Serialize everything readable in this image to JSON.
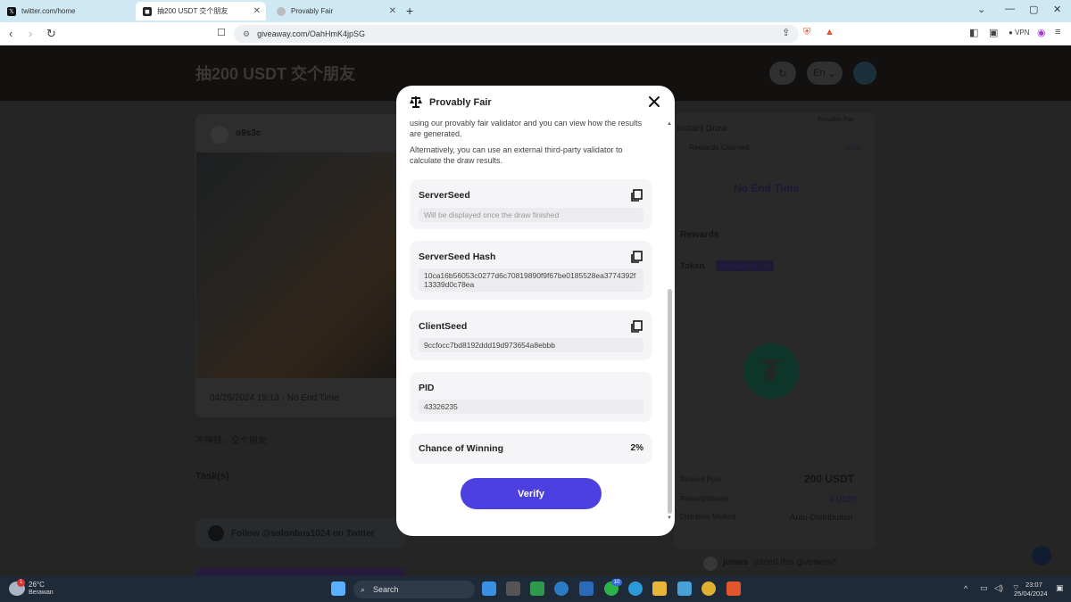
{
  "browser": {
    "tabs": [
      {
        "label": "twitter.com/home"
      },
      {
        "label": "抽200 USDT 交个朋友"
      },
      {
        "label": "Provably Fair"
      }
    ],
    "url": "giveaway.com/OahHmK4jpSG",
    "vpn_label": "VPN"
  },
  "page": {
    "title": "抽200 USDT 交个朋友",
    "lang": "En",
    "user": "o9s3c",
    "date_range": "04/25/2024 19:13 - No End Time",
    "description": "不挣钱，交个朋友",
    "tasks_heading": "Task(s)",
    "task_follow": "Follow",
    "task_handle": "@solonbus1024",
    "task_suffix": "on Twitter",
    "right": {
      "provably_fair": "Provably Fair",
      "instant_draw": "Instant Draw",
      "rewards_claimed": "Rewards Claimed",
      "rewards_count": "0/50",
      "no_end_time": "No End Time",
      "rewards_heading": "Rewards",
      "token_label": "Token",
      "remaining": "Remaining: 50",
      "reward_pool_label": "Reward Pool",
      "reward_pool_value": "200 USDT",
      "reward_winner_label": "Reward/Winner",
      "reward_winner_value": "4 USDT",
      "distribute_label": "Distribute Method",
      "distribute_value": "Auto-Distribution",
      "joined_user": "juwas",
      "joined_text": "joined this giveaway!"
    }
  },
  "modal": {
    "title": "Provably Fair",
    "intro_1": "using our provably fair validator and you can view how the results are generated.",
    "intro_2": "Alternatively, you can use an external third-party validator to calculate the draw results.",
    "fields": [
      {
        "label": "ServerSeed",
        "value": "Will be displayed once the draw finished"
      },
      {
        "label": "ServerSeed Hash",
        "value": "10ca16b56053c0277d6c70819890f9f67be0185528ea3774392f13339d0c78ea"
      },
      {
        "label": "ClientSeed",
        "value": "9ccfocc7bd8192ddd19d973654a8ebbb"
      },
      {
        "label": "PID",
        "value": "43326235"
      }
    ],
    "chance_label": "Chance of Winning",
    "chance_value": "2%",
    "verify_label": "Verify"
  },
  "taskbar": {
    "weather_temp": "26°C",
    "weather_desc": "Berawan",
    "search_label": "Search",
    "time": "23:07",
    "date": "25/04/2024",
    "weather_badge": "1",
    "chat_badge": "10"
  },
  "colors": {
    "accent": "#4c41e0",
    "tether": "#15523f",
    "tabbar": "#cfe9f4"
  }
}
